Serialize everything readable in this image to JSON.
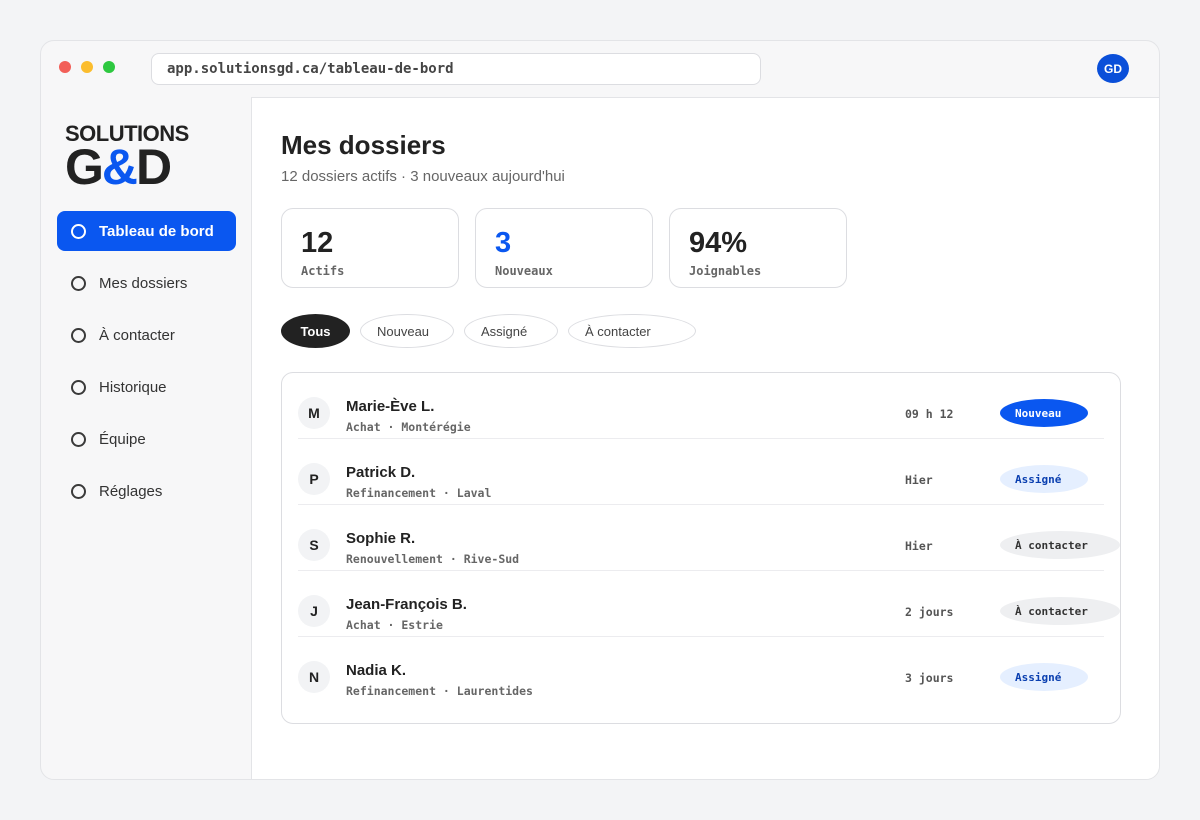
{
  "browser": {
    "url": "app.solutionsgd.ca/tableau-de-bord",
    "user_initials": "GD"
  },
  "logo": {
    "line1": "SOLUTIONS",
    "g": "G",
    "amp": "&",
    "d": "D"
  },
  "sidebar": {
    "items": [
      {
        "label": "Tableau de bord",
        "active": true
      },
      {
        "label": "Mes dossiers",
        "active": false
      },
      {
        "label": "À contacter",
        "active": false
      },
      {
        "label": "Historique",
        "active": false
      },
      {
        "label": "Équipe",
        "active": false
      },
      {
        "label": "Réglages",
        "active": false
      }
    ]
  },
  "main": {
    "title": "Mes dossiers",
    "subtitle": "12 dossiers actifs · 3 nouveaux aujourd'hui",
    "stats": [
      {
        "value": "12",
        "label": "Actifs"
      },
      {
        "value": "3",
        "label": "Nouveaux"
      },
      {
        "value": "94%",
        "label": "Joignables"
      }
    ],
    "filters": [
      {
        "label": "Tous",
        "active": true
      },
      {
        "label": "Nouveau",
        "active": false
      },
      {
        "label": "Assigné",
        "active": false
      },
      {
        "label": "À contacter",
        "active": false
      }
    ],
    "rows": [
      {
        "initial": "M",
        "name": "Marie-Ève L.",
        "meta": "Achat · Montérégie",
        "time": "09 h 12",
        "status": "Nouveau"
      },
      {
        "initial": "P",
        "name": "Patrick D.",
        "meta": "Refinancement · Laval",
        "time": "Hier",
        "status": "Assigné"
      },
      {
        "initial": "S",
        "name": "Sophie R.",
        "meta": "Renouvellement · Rive-Sud",
        "time": "Hier",
        "status": "À contacter"
      },
      {
        "initial": "J",
        "name": "Jean-François B.",
        "meta": "Achat · Estrie",
        "time": "2 jours",
        "status": "À contacter"
      },
      {
        "initial": "N",
        "name": "Nadia K.",
        "meta": "Refinancement · Laurentides",
        "time": "3 jours",
        "status": "Assigné"
      }
    ]
  },
  "colors": {
    "accent": "#0a57f0",
    "badge_assigned_bg": "#e5efff",
    "badge_contact_bg": "#eeeff1",
    "chip_active_bg": "#222222"
  }
}
